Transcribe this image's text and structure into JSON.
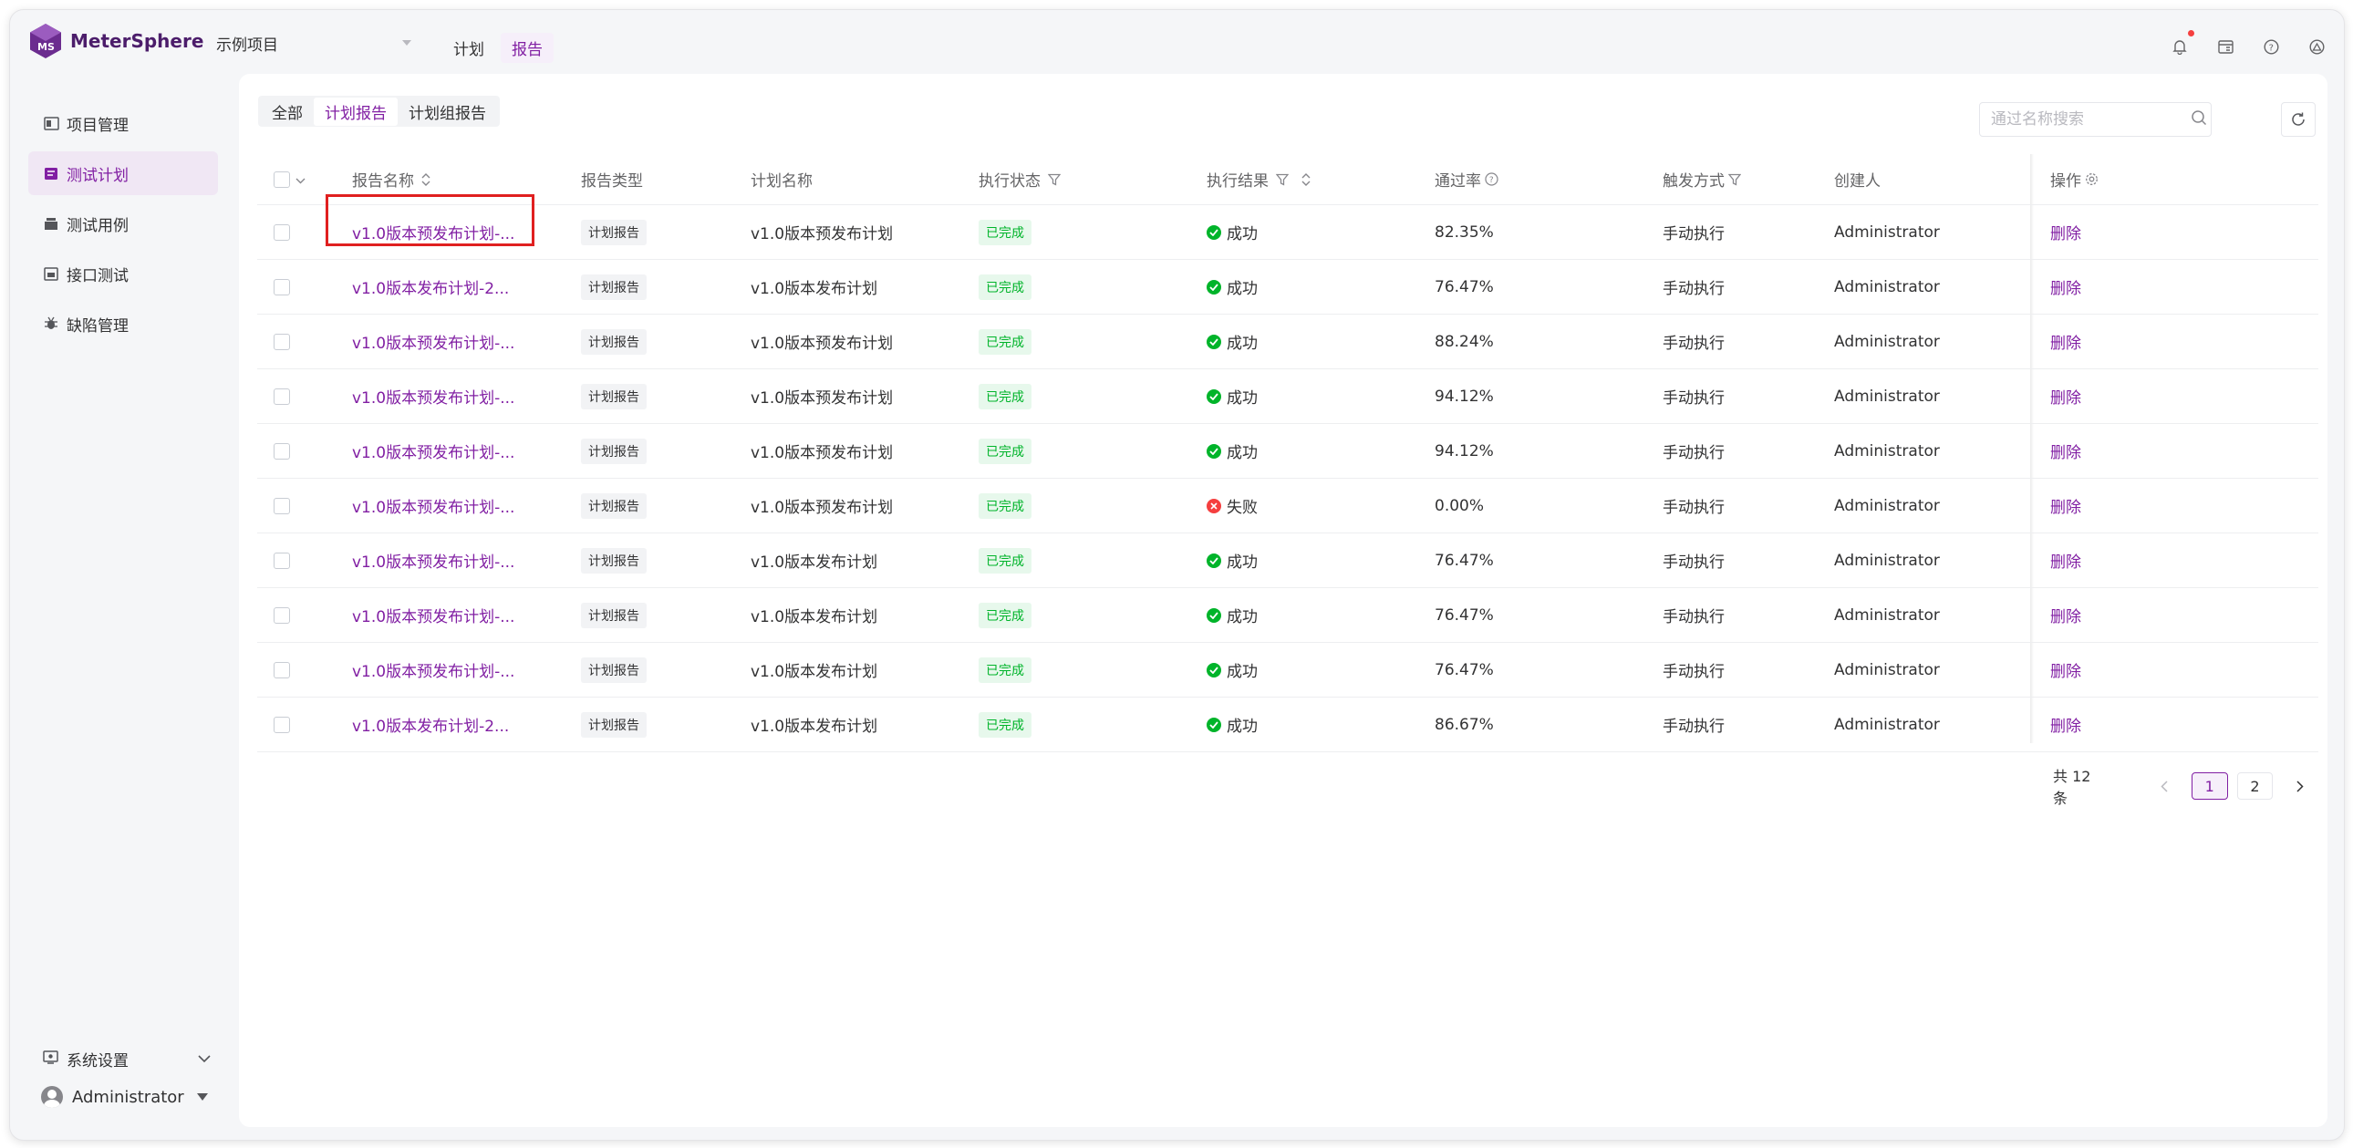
{
  "app": {
    "name": "MeterSphere",
    "brand_color": "#811fa3"
  },
  "header": {
    "project": "示例项目",
    "nav": [
      {
        "label": "计划",
        "active": false
      },
      {
        "label": "报告",
        "active": true
      }
    ],
    "icons": [
      "bell-icon",
      "calendar-icon",
      "help-icon",
      "org-icon"
    ]
  },
  "sidebar": {
    "items": [
      {
        "label": "项目管理",
        "icon": "project-icon",
        "active": false
      },
      {
        "label": "测试计划",
        "icon": "test-plan-icon",
        "active": true
      },
      {
        "label": "测试用例",
        "icon": "test-case-icon",
        "active": false
      },
      {
        "label": "接口测试",
        "icon": "api-test-icon",
        "active": false
      },
      {
        "label": "缺陷管理",
        "icon": "bug-icon",
        "active": false
      }
    ],
    "system_settings": "系统设置",
    "user": "Administrator"
  },
  "toolbar": {
    "segments": [
      {
        "label": "全部",
        "active": false
      },
      {
        "label": "计划报告",
        "active": true
      },
      {
        "label": "计划组报告",
        "active": false
      }
    ],
    "search_placeholder": "通过名称搜索"
  },
  "table": {
    "headers": {
      "name": "报告名称",
      "type": "报告类型",
      "plan": "计划名称",
      "status": "执行状态",
      "result": "执行结果",
      "rate": "通过率",
      "trigger": "触发方式",
      "creator": "创建人",
      "op": "操作"
    },
    "rows": [
      {
        "name": "v1.0版本预发布计划-...",
        "type": "计划报告",
        "plan": "v1.0版本预发布计划",
        "status": "已完成",
        "result": "成功",
        "ok": true,
        "rate": "82.35%",
        "trigger": "手动执行",
        "creator": "Administrator",
        "op": "删除"
      },
      {
        "name": "v1.0版本发布计划-2...",
        "type": "计划报告",
        "plan": "v1.0版本发布计划",
        "status": "已完成",
        "result": "成功",
        "ok": true,
        "rate": "76.47%",
        "trigger": "手动执行",
        "creator": "Administrator",
        "op": "删除"
      },
      {
        "name": "v1.0版本预发布计划-...",
        "type": "计划报告",
        "plan": "v1.0版本预发布计划",
        "status": "已完成",
        "result": "成功",
        "ok": true,
        "rate": "88.24%",
        "trigger": "手动执行",
        "creator": "Administrator",
        "op": "删除"
      },
      {
        "name": "v1.0版本预发布计划-...",
        "type": "计划报告",
        "plan": "v1.0版本预发布计划",
        "status": "已完成",
        "result": "成功",
        "ok": true,
        "rate": "94.12%",
        "trigger": "手动执行",
        "creator": "Administrator",
        "op": "删除"
      },
      {
        "name": "v1.0版本预发布计划-...",
        "type": "计划报告",
        "plan": "v1.0版本预发布计划",
        "status": "已完成",
        "result": "成功",
        "ok": true,
        "rate": "94.12%",
        "trigger": "手动执行",
        "creator": "Administrator",
        "op": "删除"
      },
      {
        "name": "v1.0版本预发布计划-...",
        "type": "计划报告",
        "plan": "v1.0版本预发布计划",
        "status": "已完成",
        "result": "失败",
        "ok": false,
        "rate": "0.00%",
        "trigger": "手动执行",
        "creator": "Administrator",
        "op": "删除"
      },
      {
        "name": "v1.0版本预发布计划-...",
        "type": "计划报告",
        "plan": "v1.0版本发布计划",
        "status": "已完成",
        "result": "成功",
        "ok": true,
        "rate": "76.47%",
        "trigger": "手动执行",
        "creator": "Administrator",
        "op": "删除"
      },
      {
        "name": "v1.0版本预发布计划-...",
        "type": "计划报告",
        "plan": "v1.0版本发布计划",
        "status": "已完成",
        "result": "成功",
        "ok": true,
        "rate": "76.47%",
        "trigger": "手动执行",
        "creator": "Administrator",
        "op": "删除"
      },
      {
        "name": "v1.0版本预发布计划-...",
        "type": "计划报告",
        "plan": "v1.0版本发布计划",
        "status": "已完成",
        "result": "成功",
        "ok": true,
        "rate": "76.47%",
        "trigger": "手动执行",
        "creator": "Administrator",
        "op": "删除"
      },
      {
        "name": "v1.0版本发布计划-2...",
        "type": "计划报告",
        "plan": "v1.0版本发布计划",
        "status": "已完成",
        "result": "成功",
        "ok": true,
        "rate": "86.67%",
        "trigger": "手动执行",
        "creator": "Administrator",
        "op": "删除"
      }
    ]
  },
  "pagination": {
    "total": "共 12 条",
    "pages": [
      "1",
      "2"
    ],
    "current": "1"
  }
}
